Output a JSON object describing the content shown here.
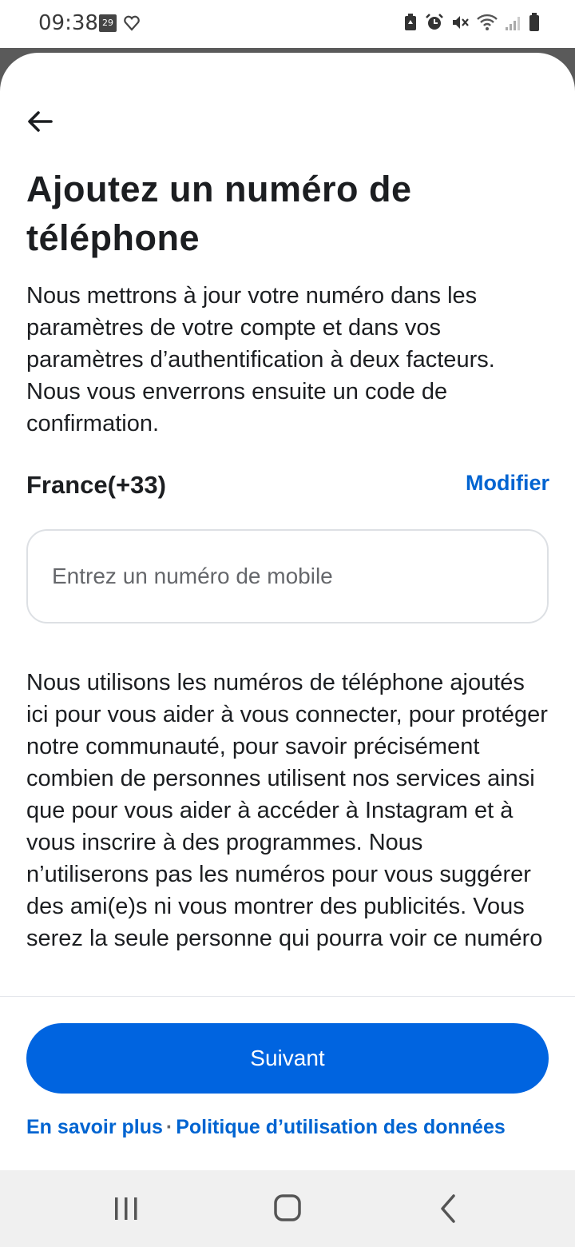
{
  "status_bar": {
    "time": "09:38",
    "calendar_day": "29",
    "icons": [
      "calendar-icon",
      "heart-outline-icon",
      "battery-saver-icon",
      "alarm-icon",
      "mute-icon",
      "wifi-icon",
      "signal-icon",
      "battery-icon"
    ]
  },
  "header": {
    "back_icon": "arrow-left-icon",
    "title": "Ajoutez un numéro de téléphone"
  },
  "intro": "Nous mettrons à jour votre numéro dans les paramètres de votre compte et dans vos paramètres d’authentification à deux facteurs. Nous vous enverrons ensuite un code de confirmation.",
  "country": {
    "label": "France(+33)",
    "modify_label": "Modifier"
  },
  "phone_input": {
    "value": "",
    "placeholder": "Entrez un numéro de mobile"
  },
  "legal_text": "Nous utilisons les numéros de téléphone ajoutés ici pour vous aider à vous connecter, pour protéger notre communauté, pour savoir précisément combien de personnes utilisent nos services ainsi que pour vous aider à accéder à Instagram et à vous inscrire à des programmes. Nous n’utiliserons pas les numéros pour vous suggérer des ami(e)s ni vous montrer des publicités. Vous serez la seule personne qui pourra voir ce numéro",
  "footer": {
    "next_label": "Suivant",
    "learn_more": "En savoir plus",
    "separator": "·",
    "data_policy": "Politique d’utilisation des données"
  },
  "nav_bar": {
    "icons": [
      "recent-apps-icon",
      "home-icon",
      "back-icon"
    ]
  },
  "colors": {
    "accent": "#0064e0",
    "link": "#0064d1",
    "text": "#1c1e21",
    "placeholder": "#65676b"
  }
}
